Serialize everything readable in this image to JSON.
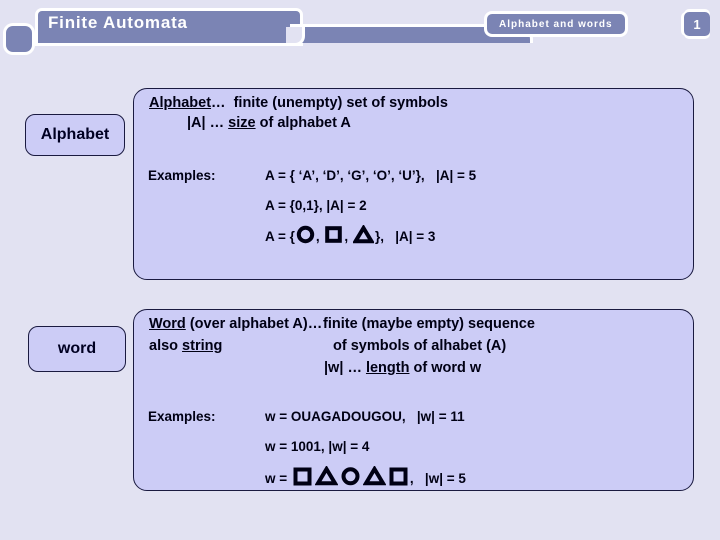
{
  "header": {
    "title": "Finite Automata",
    "topic_chip": "Alphabet and words",
    "slide_number": "1",
    "banner_color": "#7b84b4",
    "corner_tab_icon": "square-tab-icon"
  },
  "page": {
    "background_color": "#e2e2f2",
    "panel_fill": "#ccccf6",
    "panel_border": "#1a1a40"
  },
  "sections": [
    {
      "label": "Alphabet",
      "definition_term": "Alphabet",
      "definition_dots": "…",
      "definition_text": "finite (unempty) set of symbols",
      "notation_term": "|A|",
      "notation_dots": "…",
      "notation_underlined": "size",
      "notation_text": "of alphabet A",
      "examples_label": "Examples:",
      "examples": [
        "A = { ‘A’, ‘D’, ‘G’, ‘O’, ‘U’},   |A|  = 5",
        "A = {0,1},  |A| = 2",
        "A = {○, □, △},   |A| = 3"
      ]
    },
    {
      "label": "word",
      "definition_term": "Word",
      "definition_qualifier": "(over alphabet A)",
      "definition_dots": "…",
      "definition_text": "finite (maybe empty) sequence",
      "definition_text2": "of symbols of alhabet (A)",
      "alias_prefix": "also",
      "alias_term": "string",
      "notation_term": "|w|",
      "notation_dots": "…",
      "notation_underlined": "length",
      "notation_text": "of word w",
      "examples_label": "Examples:",
      "examples": [
        "w = OUAGADOUGOU,   |w|  = 11",
        "w = 1001,  |w| = 4",
        "w = □△○△□,  |w| = 5"
      ]
    }
  ],
  "shapes": {
    "circle": "circle-shape",
    "square": "square-shape",
    "triangle": "triangle-shape"
  },
  "literals": {
    "a_ex1_prefix": "A = { ‘A’, ‘D’, ‘G’, ‘O’, ‘U’},",
    "a_ex1_size": "|A|  = 5",
    "a_ex2": "A = {0,1},  |A| = 2",
    "a_ex3_open": "A = {",
    "a_ex3_comma1": ",",
    "a_ex3_comma2": ",",
    "a_ex3_close": "},",
    "a_ex3_size": "|A| = 3",
    "w_ex1_prefix": "w = OUAGADOUGOU,",
    "w_ex1_size": "|w|  = 11",
    "w_ex2": "w = 1001,  |w| = 4",
    "w_ex3_open": "w = ",
    "w_ex3_comma": ",",
    "w_ex3_size": "|w| = 5"
  }
}
